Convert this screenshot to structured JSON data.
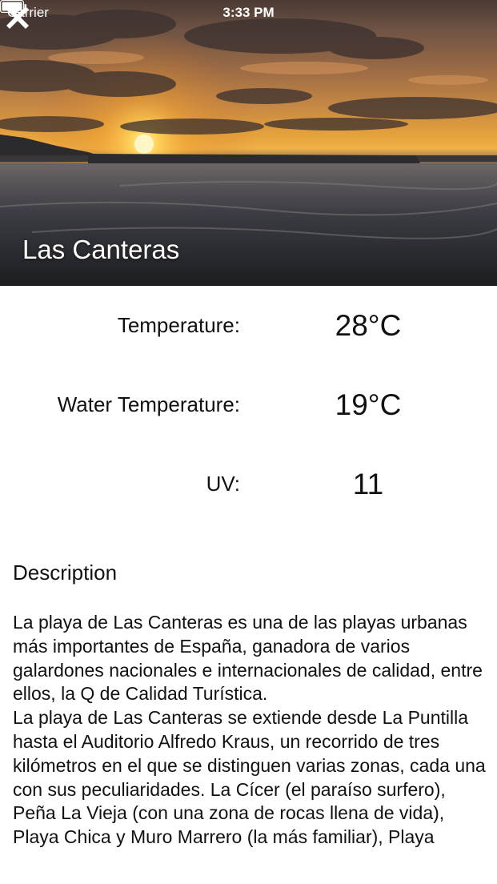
{
  "status_bar": {
    "carrier": "Carrier",
    "time": "3:33 PM"
  },
  "header": {
    "beach_name": "Las Canteras",
    "close_icon": "close-x-icon"
  },
  "stats": [
    {
      "label": "Temperature:",
      "value": "28°C"
    },
    {
      "label": "Water Temperature:",
      "value": "19°C"
    },
    {
      "label": "UV:",
      "value": "11"
    }
  ],
  "description": {
    "heading": "Description",
    "body": "La playa de Las Canteras es una de las playas urbanas más importantes de España, ganadora de varios galardones nacionales e internacionales de calidad, entre ellos,  la Q de Calidad Turística.\nLa playa de Las Canteras se extiende desde La Puntilla hasta el Auditorio Alfredo Kraus, un recorrido de tres kilómetros en el que se distinguen varias zonas, cada una con sus peculiaridades. La Cícer (el paraíso surfero), Peña La Vieja (con una zona de rocas llena de vida), Playa Chica y Muro Marrero (la más familiar), Playa"
  }
}
